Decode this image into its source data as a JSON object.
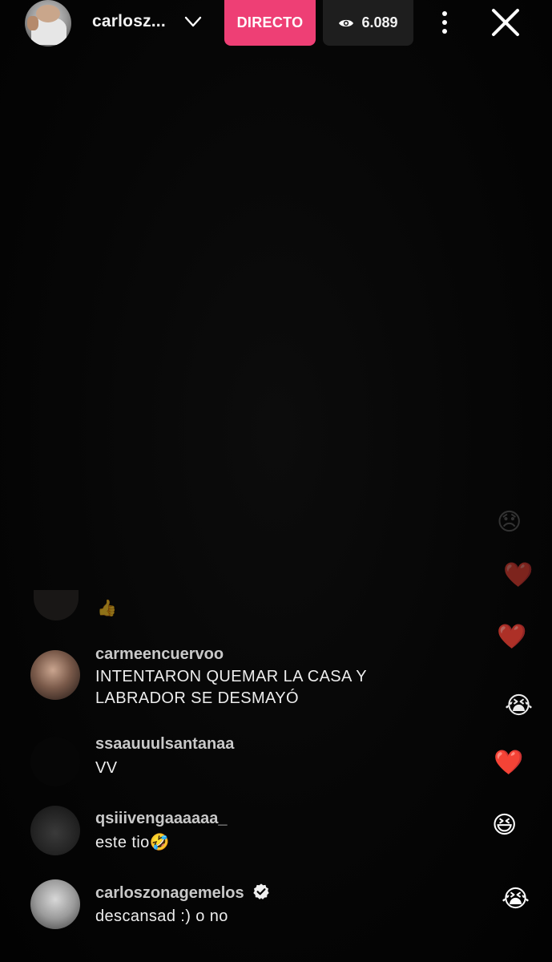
{
  "header": {
    "host_name": "carlosz...",
    "live_label": "DIRECTO",
    "viewer_count": "6.089"
  },
  "comments": [
    {
      "username": "carmeencuervoo",
      "lines": [
        "INTENTARON QUEMAR LA CASA Y",
        "LABRADOR SE DESMAYÓ"
      ]
    },
    {
      "username": "ssaauuulsantanaa",
      "lines": [
        "VV"
      ]
    },
    {
      "username": "qsiiivengaaaaaa_",
      "lines": [
        "este tio🤣"
      ]
    },
    {
      "username": "carloszonagemelos",
      "lines": [
        "descansad :) o no"
      ],
      "verified": true
    }
  ],
  "faded_comment_emoji": "👍",
  "reactions": [
    "😞",
    "❤️",
    "❤️",
    "😭",
    "❤️",
    "😆",
    "😭"
  ],
  "colors": {
    "live_badge": "#ee3f75",
    "viewer_pill": "#1e1e1e",
    "background": "#050505"
  }
}
